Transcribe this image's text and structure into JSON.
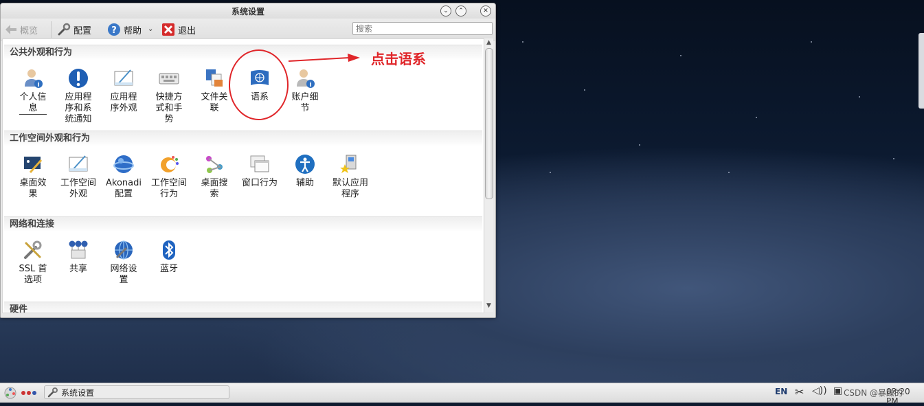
{
  "window": {
    "title": "系统设置"
  },
  "toolbar": {
    "overview": "概览",
    "configure": "配置",
    "help": "帮助",
    "quit": "退出",
    "search_placeholder": "搜索"
  },
  "sections": [
    {
      "title": "公共外观和行为",
      "items": [
        {
          "label": "个人信\n息",
          "icon": "user-info-icon"
        },
        {
          "label": "应用程\n序和系\n统通知",
          "icon": "notification-icon"
        },
        {
          "label": "应用程\n序外观",
          "icon": "app-appearance-icon"
        },
        {
          "label": "快捷方\n式和手\n势",
          "icon": "keyboard-shortcuts-icon"
        },
        {
          "label": "文件关\n联",
          "icon": "file-association-icon"
        },
        {
          "label": "语系",
          "icon": "locale-flag-icon"
        },
        {
          "label": "账户细\n节",
          "icon": "account-details-icon"
        }
      ]
    },
    {
      "title": "工作空间外观和行为",
      "items": [
        {
          "label": "桌面效\n果",
          "icon": "desktop-effects-icon"
        },
        {
          "label": "工作空间\n外观",
          "icon": "workspace-appearance-icon"
        },
        {
          "label": "Akonadi\n配置",
          "icon": "akonadi-icon"
        },
        {
          "label": "工作空间\n行为",
          "icon": "workspace-behavior-icon"
        },
        {
          "label": "桌面搜\n索",
          "icon": "desktop-search-icon"
        },
        {
          "label": "窗口行为",
          "icon": "window-behavior-icon"
        },
        {
          "label": "辅助",
          "icon": "accessibility-icon"
        },
        {
          "label": "默认应用\n程序",
          "icon": "default-apps-icon"
        }
      ]
    },
    {
      "title": "网络和连接",
      "items": [
        {
          "label": "SSL 首\n选项",
          "icon": "ssl-tools-icon"
        },
        {
          "label": "共享",
          "icon": "sharing-icon"
        },
        {
          "label": "网络设\n置",
          "icon": "network-settings-icon"
        },
        {
          "label": "蓝牙",
          "icon": "bluetooth-icon"
        }
      ]
    },
    {
      "title": "硬件",
      "items": []
    }
  ],
  "annotation": {
    "text": "点击语系",
    "color": "#e0262a"
  },
  "taskbar": {
    "task_label": "系统设置",
    "keyboard_layout": "EN",
    "clock": "03:20 PM",
    "watermark": "CSDN @暴躁的"
  }
}
